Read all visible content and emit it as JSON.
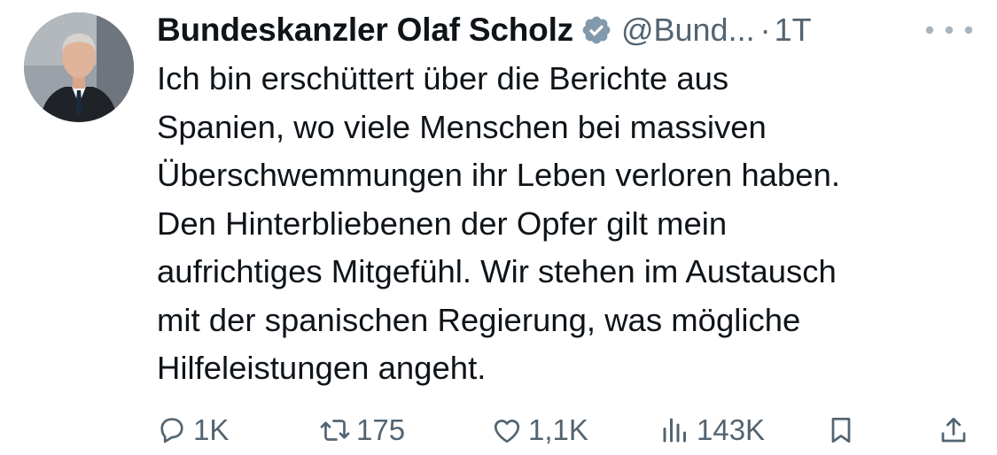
{
  "author": {
    "display_name": "Bundeskanzler Olaf Scholz",
    "handle": "@Bund...",
    "separator": "·",
    "time": "1T",
    "verified_color": "#829aab"
  },
  "tweet": {
    "text": "Ich bin erschüttert über die Berichte aus\nSpanien, wo viele Menschen bei massiven\nÜberschwemmungen ihr Leben verloren haben.\nDen Hinterbliebenen der Opfer gilt mein\naufrichtiges Mitgefühl. Wir stehen im Austausch\nmit der spanischen Regierung, was mögliche\nHilfeleistungen angeht."
  },
  "actions": {
    "replies": "1K",
    "retweets": "175",
    "likes": "1,1K",
    "views": "143K"
  },
  "icons": {
    "more": "more-horizontal-icon",
    "reply": "reply-icon",
    "retweet": "retweet-icon",
    "like": "heart-icon",
    "views": "views-icon",
    "bookmark": "bookmark-icon",
    "share": "share-icon"
  }
}
